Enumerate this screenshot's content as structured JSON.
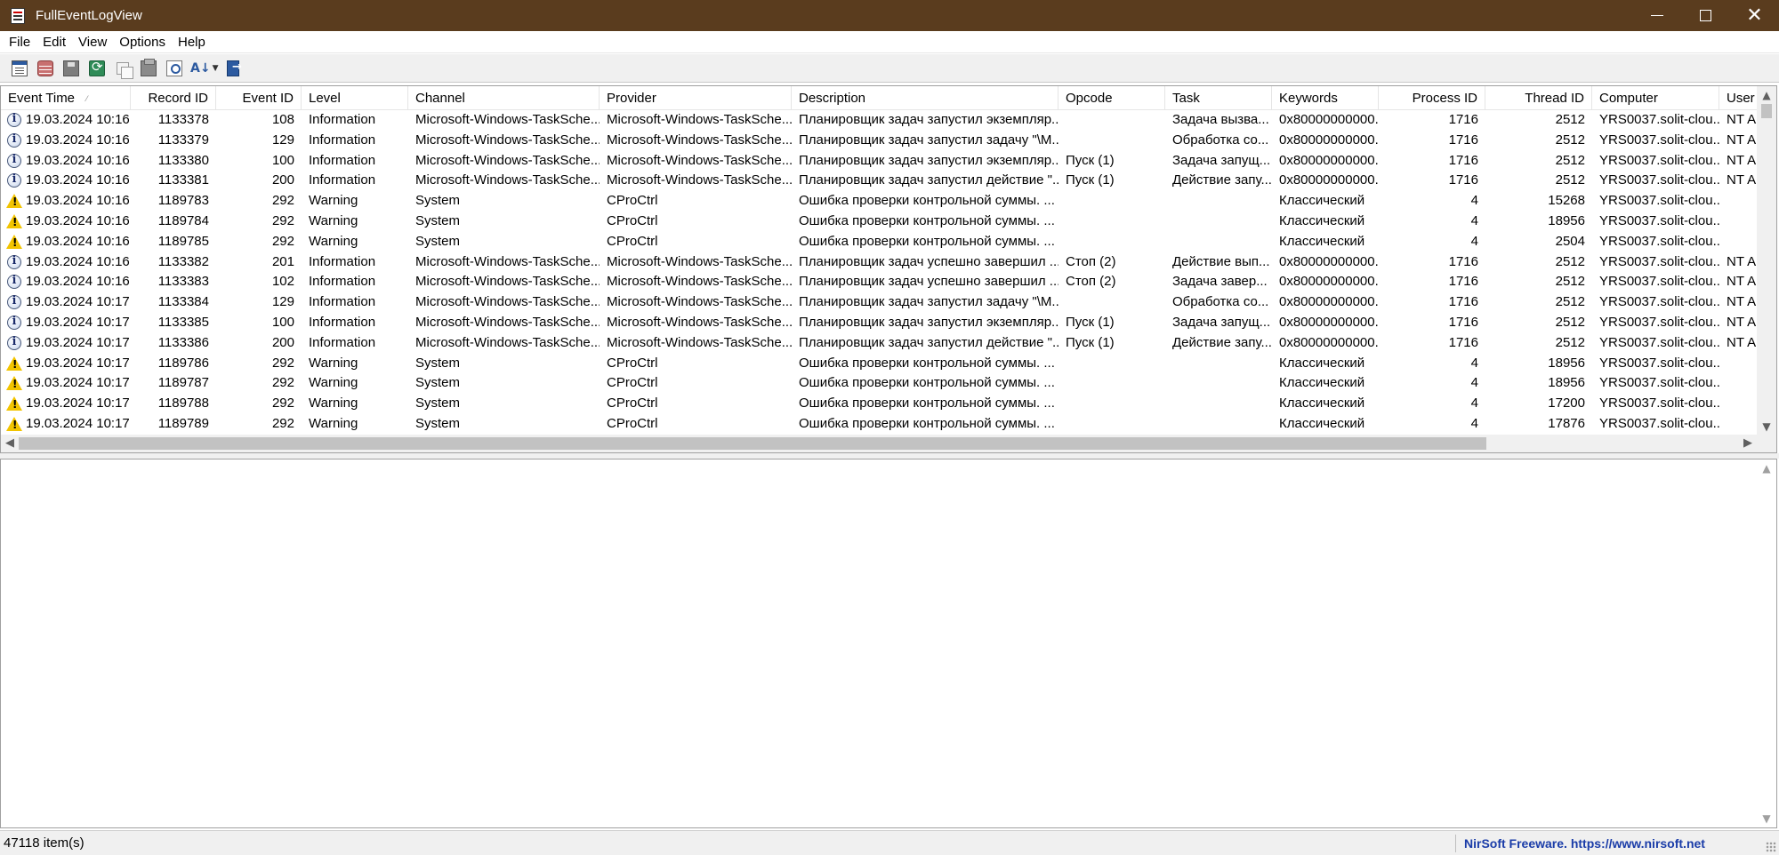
{
  "window": {
    "title": "FullEventLogView",
    "icon": "app-icon"
  },
  "menu": [
    "File",
    "Edit",
    "View",
    "Options",
    "Help"
  ],
  "toolbar": {
    "buttons": [
      "properties-icon",
      "select-source-icon",
      "save-icon",
      "refresh-icon",
      "copy-icon",
      "html-report-icon",
      "find-icon",
      "sort-icon",
      "exit-icon"
    ]
  },
  "columns": [
    {
      "key": "time",
      "label": "Event Time",
      "align": "left"
    },
    {
      "key": "record",
      "label": "Record ID",
      "align": "right"
    },
    {
      "key": "eventid",
      "label": "Event ID",
      "align": "right"
    },
    {
      "key": "level",
      "label": "Level",
      "align": "left"
    },
    {
      "key": "channel",
      "label": "Channel",
      "align": "left"
    },
    {
      "key": "provider",
      "label": "Provider",
      "align": "left"
    },
    {
      "key": "description",
      "label": "Description",
      "align": "left"
    },
    {
      "key": "opcode",
      "label": "Opcode",
      "align": "left"
    },
    {
      "key": "task",
      "label": "Task",
      "align": "left"
    },
    {
      "key": "keywords",
      "label": "Keywords",
      "align": "left"
    },
    {
      "key": "pid",
      "label": "Process ID",
      "align": "right"
    },
    {
      "key": "tid",
      "label": "Thread ID",
      "align": "right"
    },
    {
      "key": "computer",
      "label": "Computer",
      "align": "left"
    },
    {
      "key": "user",
      "label": "User",
      "align": "left"
    }
  ],
  "rows": [
    {
      "time": "19.03.2024 10:16:...",
      "record": "1133378",
      "eventid": "108",
      "level": "Information",
      "channel": "Microsoft-Windows-TaskSche...",
      "provider": "Microsoft-Windows-TaskSche...",
      "description": "Планировщик задач запустил экземпляр...",
      "opcode": "",
      "task": "Задача вызва...",
      "keywords": "0x80000000000...",
      "pid": "1716",
      "tid": "2512",
      "computer": "YRS0037.solit-clou...",
      "user": "NT AU"
    },
    {
      "time": "19.03.2024 10:16:...",
      "record": "1133379",
      "eventid": "129",
      "level": "Information",
      "channel": "Microsoft-Windows-TaskSche...",
      "provider": "Microsoft-Windows-TaskSche...",
      "description": "Планировщик задач запустил задачу \"\\M...",
      "opcode": "",
      "task": "Обработка со...",
      "keywords": "0x80000000000...",
      "pid": "1716",
      "tid": "2512",
      "computer": "YRS0037.solit-clou...",
      "user": "NT AU"
    },
    {
      "time": "19.03.2024 10:16:...",
      "record": "1133380",
      "eventid": "100",
      "level": "Information",
      "channel": "Microsoft-Windows-TaskSche...",
      "provider": "Microsoft-Windows-TaskSche...",
      "description": "Планировщик задач запустил экземпляр...",
      "opcode": "Пуск (1)",
      "task": "Задача запущ...",
      "keywords": "0x80000000000...",
      "pid": "1716",
      "tid": "2512",
      "computer": "YRS0037.solit-clou...",
      "user": "NT AU"
    },
    {
      "time": "19.03.2024 10:16:...",
      "record": "1133381",
      "eventid": "200",
      "level": "Information",
      "channel": "Microsoft-Windows-TaskSche...",
      "provider": "Microsoft-Windows-TaskSche...",
      "description": "Планировщик задач запустил действие \"...",
      "opcode": "Пуск (1)",
      "task": "Действие запу...",
      "keywords": "0x80000000000...",
      "pid": "1716",
      "tid": "2512",
      "computer": "YRS0037.solit-clou...",
      "user": "NT AU"
    },
    {
      "time": "19.03.2024 10:16:...",
      "record": "1189783",
      "eventid": "292",
      "level": "Warning",
      "channel": "System",
      "provider": "CProCtrl",
      "description": "Ошибка проверки контрольной суммы. ...",
      "opcode": "",
      "task": "",
      "keywords": "Классический",
      "pid": "4",
      "tid": "15268",
      "computer": "YRS0037.solit-clou...",
      "user": ""
    },
    {
      "time": "19.03.2024 10:16:...",
      "record": "1189784",
      "eventid": "292",
      "level": "Warning",
      "channel": "System",
      "provider": "CProCtrl",
      "description": "Ошибка проверки контрольной суммы. ...",
      "opcode": "",
      "task": "",
      "keywords": "Классический",
      "pid": "4",
      "tid": "18956",
      "computer": "YRS0037.solit-clou...",
      "user": ""
    },
    {
      "time": "19.03.2024 10:16:...",
      "record": "1189785",
      "eventid": "292",
      "level": "Warning",
      "channel": "System",
      "provider": "CProCtrl",
      "description": "Ошибка проверки контрольной суммы. ...",
      "opcode": "",
      "task": "",
      "keywords": "Классический",
      "pid": "4",
      "tid": "2504",
      "computer": "YRS0037.solit-clou...",
      "user": ""
    },
    {
      "time": "19.03.2024 10:16:...",
      "record": "1133382",
      "eventid": "201",
      "level": "Information",
      "channel": "Microsoft-Windows-TaskSche...",
      "provider": "Microsoft-Windows-TaskSche...",
      "description": "Планировщик задач успешно завершил ...",
      "opcode": "Стоп (2)",
      "task": "Действие вып...",
      "keywords": "0x80000000000...",
      "pid": "1716",
      "tid": "2512",
      "computer": "YRS0037.solit-clou...",
      "user": "NT AU"
    },
    {
      "time": "19.03.2024 10:16:...",
      "record": "1133383",
      "eventid": "102",
      "level": "Information",
      "channel": "Microsoft-Windows-TaskSche...",
      "provider": "Microsoft-Windows-TaskSche...",
      "description": "Планировщик задач успешно завершил ...",
      "opcode": "Стоп (2)",
      "task": "Задача завер...",
      "keywords": "0x80000000000...",
      "pid": "1716",
      "tid": "2512",
      "computer": "YRS0037.solit-clou...",
      "user": "NT AU"
    },
    {
      "time": "19.03.2024 10:17:...",
      "record": "1133384",
      "eventid": "129",
      "level": "Information",
      "channel": "Microsoft-Windows-TaskSche...",
      "provider": "Microsoft-Windows-TaskSche...",
      "description": "Планировщик задач запустил задачу \"\\M...",
      "opcode": "",
      "task": "Обработка со...",
      "keywords": "0x80000000000...",
      "pid": "1716",
      "tid": "2512",
      "computer": "YRS0037.solit-clou...",
      "user": "NT AU"
    },
    {
      "time": "19.03.2024 10:17:...",
      "record": "1133385",
      "eventid": "100",
      "level": "Information",
      "channel": "Microsoft-Windows-TaskSche...",
      "provider": "Microsoft-Windows-TaskSche...",
      "description": "Планировщик задач запустил экземпляр...",
      "opcode": "Пуск (1)",
      "task": "Задача запущ...",
      "keywords": "0x80000000000...",
      "pid": "1716",
      "tid": "2512",
      "computer": "YRS0037.solit-clou...",
      "user": "NT AU"
    },
    {
      "time": "19.03.2024 10:17:...",
      "record": "1133386",
      "eventid": "200",
      "level": "Information",
      "channel": "Microsoft-Windows-TaskSche...",
      "provider": "Microsoft-Windows-TaskSche...",
      "description": "Планировщик задач запустил действие \"...",
      "opcode": "Пуск (1)",
      "task": "Действие запу...",
      "keywords": "0x80000000000...",
      "pid": "1716",
      "tid": "2512",
      "computer": "YRS0037.solit-clou...",
      "user": "NT AU"
    },
    {
      "time": "19.03.2024 10:17:...",
      "record": "1189786",
      "eventid": "292",
      "level": "Warning",
      "channel": "System",
      "provider": "CProCtrl",
      "description": "Ошибка проверки контрольной суммы. ...",
      "opcode": "",
      "task": "",
      "keywords": "Классический",
      "pid": "4",
      "tid": "18956",
      "computer": "YRS0037.solit-clou...",
      "user": ""
    },
    {
      "time": "19.03.2024 10:17:...",
      "record": "1189787",
      "eventid": "292",
      "level": "Warning",
      "channel": "System",
      "provider": "CProCtrl",
      "description": "Ошибка проверки контрольной суммы. ...",
      "opcode": "",
      "task": "",
      "keywords": "Классический",
      "pid": "4",
      "tid": "18956",
      "computer": "YRS0037.solit-clou...",
      "user": ""
    },
    {
      "time": "19.03.2024 10:17:...",
      "record": "1189788",
      "eventid": "292",
      "level": "Warning",
      "channel": "System",
      "provider": "CProCtrl",
      "description": "Ошибка проверки контрольной суммы. ...",
      "opcode": "",
      "task": "",
      "keywords": "Классический",
      "pid": "4",
      "tid": "17200",
      "computer": "YRS0037.solit-clou...",
      "user": ""
    },
    {
      "time": "19.03.2024 10:17:...",
      "record": "1189789",
      "eventid": "292",
      "level": "Warning",
      "channel": "System",
      "provider": "CProCtrl",
      "description": "Ошибка проверки контрольной суммы. ...",
      "opcode": "",
      "task": "",
      "keywords": "Классический",
      "pid": "4",
      "tid": "17876",
      "computer": "YRS0037.solit-clou...",
      "user": ""
    }
  ],
  "status": {
    "count": "47118 item(s)",
    "link": "NirSoft Freeware. https://www.nirsoft.net"
  },
  "colors": {
    "titlebar": "#5a3c1e",
    "link": "#1a3ca8",
    "warning": "#f2c400"
  }
}
